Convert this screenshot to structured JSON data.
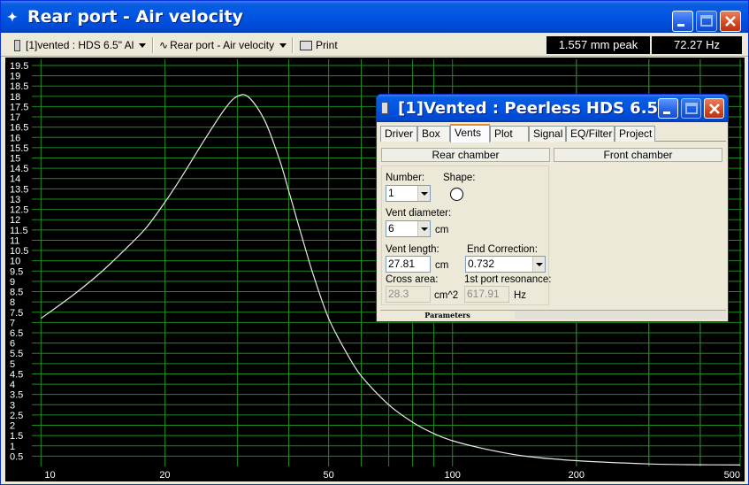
{
  "window": {
    "title": "Rear port - Air velocity"
  },
  "toolbar": {
    "project_select": "[1]vented : HDS 6.5\" Al",
    "graph_select": "Rear port - Air velocity",
    "print_label": "Print",
    "readout_peak": "1.557 mm peak",
    "readout_freq": "72.27 Hz"
  },
  "chart_data": {
    "type": "line",
    "x": [
      10,
      12,
      14,
      16,
      18,
      20,
      22,
      25,
      28,
      30,
      32,
      35,
      38,
      40,
      43,
      46,
      50,
      55,
      60,
      70,
      80,
      90,
      100,
      120,
      150,
      200,
      300,
      400,
      500
    ],
    "series": [
      {
        "values": [
          7.2,
          8.35,
          9.45,
          10.55,
          11.6,
          12.85,
          14.1,
          15.9,
          17.4,
          18.0,
          17.95,
          16.8,
          14.9,
          13.4,
          11.2,
          9.25,
          7.2,
          5.6,
          4.4,
          3.0,
          2.15,
          1.6,
          1.25,
          0.85,
          0.5,
          0.28,
          0.12,
          0.08,
          0.07
        ]
      }
    ],
    "xlim": [
      9.5,
      505
    ],
    "ylim": [
      0,
      19.8
    ],
    "x_ticks": [
      "10",
      "20",
      "50",
      "100",
      "200",
      "500"
    ],
    "y_ticks": [
      "0.5",
      "1",
      "1.5",
      "2",
      "2.5",
      "3",
      "3.5",
      "4",
      "4.5",
      "5",
      "5.5",
      "6",
      "6.5",
      "7",
      "7.5",
      "8",
      "8.5",
      "9",
      "9.5",
      "10",
      "10.5",
      "11",
      "11.5",
      "12",
      "12.5",
      "13",
      "13.5",
      "14",
      "14.5",
      "15",
      "15.5",
      "16",
      "16.5",
      "17",
      "17.5",
      "18",
      "18.5",
      "19",
      "19.5"
    ],
    "x_scale": "log",
    "grid": true,
    "colors": {
      "background": "#000000",
      "grid": "#1e8a1e",
      "curve": "#e8e8e8",
      "ticks": "#ffffff"
    }
  },
  "dialog": {
    "title": "[1]Vented : Peerless HDS 6.5...",
    "tabs": [
      "Driver",
      "Box",
      "Vents",
      "Plot",
      "Signal",
      "EQ/Filter",
      "Project"
    ],
    "active_tab": "Vents",
    "rear_chamber": "Rear chamber",
    "front_chamber": "Front chamber",
    "number_label": "Number:",
    "number_value": "1",
    "shape_label": "Shape:",
    "vent_diameter_label": "Vent diameter:",
    "vent_diameter_value": "6",
    "cm_unit": "cm",
    "vent_length_label": "Vent length:",
    "vent_length_value": "27.81",
    "end_correction_label": "End Correction:",
    "end_correction_value": "0.732",
    "cross_area_label": "Cross area:",
    "cross_area_value": "28.3",
    "cross_area_unit": "cm^2",
    "port_resonance_label": "1st port resonance:",
    "port_resonance_value": "617.91",
    "hz_unit": "Hz",
    "status_label": "Parameters"
  }
}
